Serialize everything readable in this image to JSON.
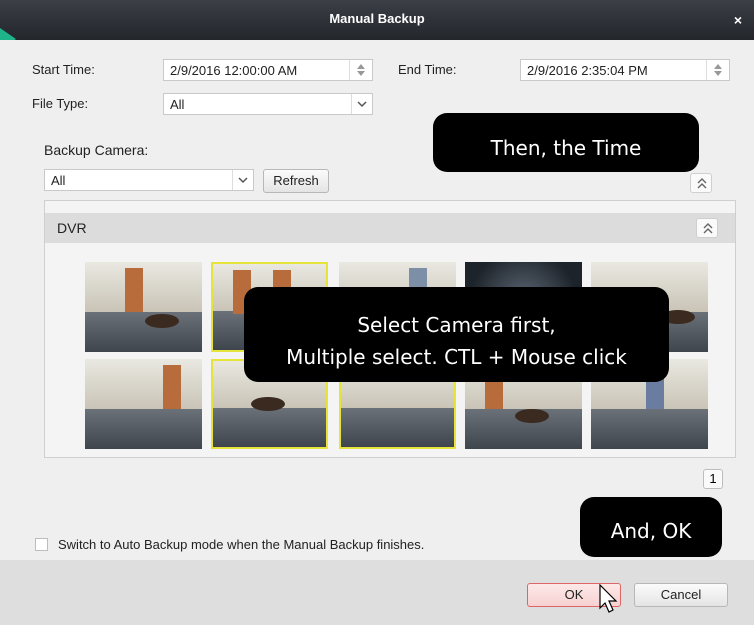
{
  "window": {
    "title": "Manual Backup",
    "close_label": "×"
  },
  "form": {
    "start_time_label": "Start Time:",
    "start_time_value": "2/9/2016 12:00:00 AM",
    "end_time_label": "End Time:",
    "end_time_value": "2/9/2016 2:35:04 PM",
    "file_type_label": "File Type:",
    "file_type_value": "All",
    "backup_camera_label": "Backup Camera:",
    "camera_filter_value": "All",
    "refresh_label": "Refresh"
  },
  "panel": {
    "group_label": "DVR"
  },
  "pagination": {
    "current_page": "1"
  },
  "footer": {
    "auto_backup_label": "Switch to Auto Backup mode when the Manual Backup finishes.",
    "ok_label": "OK",
    "cancel_label": "Cancel"
  },
  "annotations": {
    "time_callout": "Then, the Time",
    "camera_callout_line1": "Select Camera first,",
    "camera_callout_line2": "Multiple select. CTL + Mouse click",
    "ok_callout": "And, OK"
  },
  "colors": {
    "accent_arrow": "#1fb38a",
    "selected_border": "#e6e43a",
    "ok_border": "#dd6666"
  },
  "icons": {
    "close": "close-icon",
    "spinner": "spinner-icon",
    "dropdown": "chevron-down-icon",
    "collapse": "chevron-double-up-icon",
    "cursor": "mouse-cursor-icon"
  }
}
